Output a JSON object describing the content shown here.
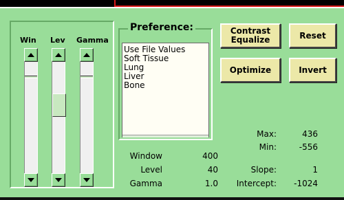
{
  "sliders": {
    "win": {
      "label": "Win",
      "position": 0.12
    },
    "lev": {
      "label": "Lev",
      "position": 0.3
    },
    "gamma": {
      "label": "Gamma",
      "position": 0.12
    }
  },
  "preference": {
    "title": "Preference:",
    "options": [
      "Use File Values",
      "Soft Tissue",
      "Lung",
      "Liver",
      "Bone"
    ]
  },
  "buttons": {
    "contrast_equalize_line1": "Contrast",
    "contrast_equalize_line2": "Equalize",
    "reset": "Reset",
    "optimize": "Optimize",
    "invert": "Invert"
  },
  "display": {
    "window_label": "Window",
    "window_value": "400",
    "level_label": "Level",
    "level_value": "40",
    "gamma_label": "Gamma",
    "gamma_value": "1.0"
  },
  "stats": {
    "max_label": "Max:",
    "max_value": "436",
    "min_label": "Min:",
    "min_value": "-556",
    "slope_label": "Slope:",
    "slope_value": "1",
    "intercept_label": "Intercept:",
    "intercept_value": "-1024"
  },
  "colors": {
    "panel": "#99dd99",
    "button": "#ece8a8",
    "list_bg": "#fffef4",
    "accent_red": "#d81a1a"
  }
}
